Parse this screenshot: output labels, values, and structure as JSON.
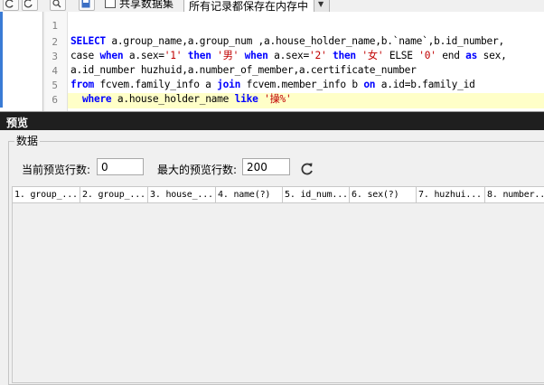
{
  "toolbar": {
    "share_dataset_label": "共享数据集",
    "record_mode_value": "所有记录都保存在内存中"
  },
  "editor": {
    "line_numbers": [
      "1",
      "2",
      "3",
      "4",
      "5",
      "6"
    ],
    "lines": [
      [],
      [
        {
          "t": "kw",
          "v": "SELECT"
        },
        {
          "t": "pl",
          "v": " a.group_name,a.group_num ,a.house_holder_name,b.`name`,b.id_number,"
        }
      ],
      [
        {
          "t": "pl",
          "v": "case "
        },
        {
          "t": "kw",
          "v": "when"
        },
        {
          "t": "pl",
          "v": " a.sex="
        },
        {
          "t": "str",
          "v": "'1'"
        },
        {
          "t": "pl",
          "v": " "
        },
        {
          "t": "kw",
          "v": "then"
        },
        {
          "t": "pl",
          "v": " "
        },
        {
          "t": "str",
          "v": "'男'"
        },
        {
          "t": "pl",
          "v": " "
        },
        {
          "t": "kw",
          "v": "when"
        },
        {
          "t": "pl",
          "v": " a.sex="
        },
        {
          "t": "str",
          "v": "'2'"
        },
        {
          "t": "pl",
          "v": " "
        },
        {
          "t": "kw",
          "v": "then"
        },
        {
          "t": "pl",
          "v": " "
        },
        {
          "t": "str",
          "v": "'女'"
        },
        {
          "t": "pl",
          "v": " ELSE "
        },
        {
          "t": "str",
          "v": "'0'"
        },
        {
          "t": "pl",
          "v": " end "
        },
        {
          "t": "kw",
          "v": "as"
        },
        {
          "t": "pl",
          "v": " sex,"
        }
      ],
      [
        {
          "t": "pl",
          "v": "a.id_number huzhuid,a.number_of_member,a.certificate_number"
        }
      ],
      [
        {
          "t": "kw",
          "v": "from"
        },
        {
          "t": "pl",
          "v": " fcvem.family_info a "
        },
        {
          "t": "kw",
          "v": "join"
        },
        {
          "t": "pl",
          "v": " fcvem.member_info b "
        },
        {
          "t": "kw",
          "v": "on"
        },
        {
          "t": "pl",
          "v": " a.id=b.family_id"
        }
      ],
      [
        {
          "t": "pl",
          "v": "  "
        },
        {
          "t": "kw",
          "v": "where"
        },
        {
          "t": "pl",
          "v": " a.house_holder_name "
        },
        {
          "t": "kw",
          "v": "like"
        },
        {
          "t": "pl",
          "v": " "
        },
        {
          "t": "str",
          "v": "'操%'"
        }
      ]
    ]
  },
  "preview": {
    "title": "预览",
    "group_label": "数据",
    "current_rows_label": "当前预览行数:",
    "current_rows_value": "0",
    "max_rows_label": "最大的预览行数:",
    "max_rows_value": "200",
    "columns": [
      "1. group_...",
      "2. group_...",
      "3. house_...",
      "4. name(?)",
      "5. id_num...",
      "6. sex(?)",
      "7. huzhui...",
      "8. number..."
    ]
  },
  "colors": {
    "keyword": "#0000ff",
    "string": "#c00000",
    "current_line": "#ffffc8",
    "title_bar": "#1f1f1f"
  }
}
